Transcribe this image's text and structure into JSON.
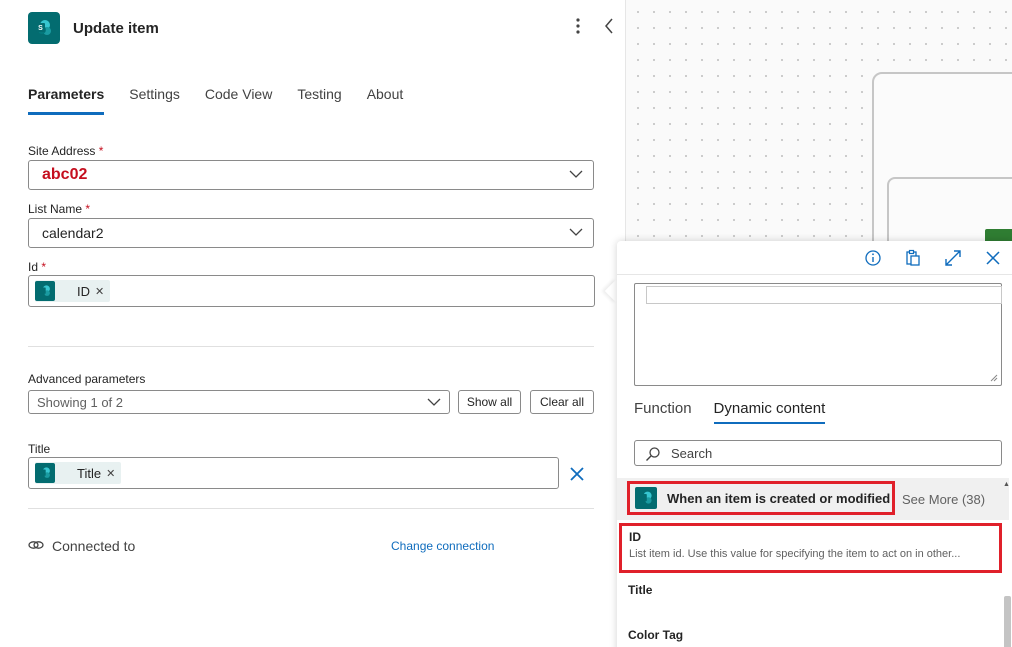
{
  "header": {
    "title": "Update item",
    "more_icon": "more-vertical-icon",
    "collapse_icon": "chevron-left-icon"
  },
  "tabs": [
    {
      "label": "Parameters",
      "active": true
    },
    {
      "label": "Settings",
      "active": false
    },
    {
      "label": "Code View",
      "active": false
    },
    {
      "label": "Testing",
      "active": false
    },
    {
      "label": "About",
      "active": false
    }
  ],
  "fields": {
    "site_address": {
      "label": "Site Address",
      "required": "*",
      "value": "abc02"
    },
    "list_name": {
      "label": "List Name",
      "required": "*",
      "value": "calendar2"
    },
    "id": {
      "label": "Id",
      "required": "*",
      "token": "ID"
    }
  },
  "advanced": {
    "label": "Advanced parameters",
    "select_value": "Showing 1 of 2",
    "show_all": "Show all",
    "clear_all": "Clear all"
  },
  "title_field": {
    "label": "Title",
    "token": "Title"
  },
  "connection": {
    "label": "Connected to",
    "link": "Change connection"
  },
  "flyout": {
    "tabs": [
      {
        "label": "Function",
        "active": false
      },
      {
        "label": "Dynamic content",
        "active": true
      }
    ],
    "search_placeholder": "Search",
    "group": {
      "name": "When an item is created or modified",
      "see_more": "See More (38)"
    },
    "items": [
      {
        "title": "ID",
        "desc": "List item id. Use this value for specifying the item to act on in other..."
      },
      {
        "title": "Title",
        "desc": ""
      },
      {
        "title": "Color Tag",
        "desc": ""
      }
    ]
  },
  "colors": {
    "accent": "#0f6cbd",
    "sharepoint": "#036c70",
    "highlight": "#e0202a",
    "required": "#c50f1f"
  }
}
